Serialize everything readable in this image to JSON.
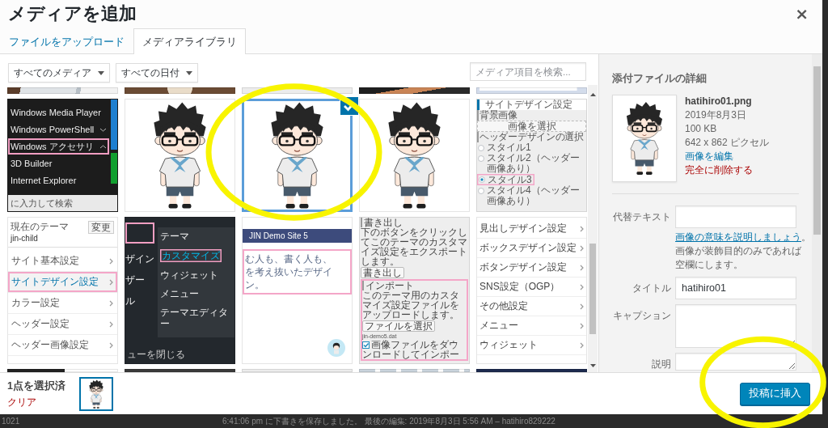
{
  "modal": {
    "title": "メディアを追加",
    "close": "×"
  },
  "tabs": [
    {
      "label": "ファイルをアップロード",
      "selected": false
    },
    {
      "label": "メディアライブラリ",
      "selected": true
    }
  ],
  "filters": [
    {
      "value": "すべてのメディア"
    },
    {
      "value": "すべての日付"
    }
  ],
  "search": {
    "placeholder": "メディア項目を検索..."
  },
  "media_items": [
    {
      "kind": "photo_desk",
      "selected": false,
      "circled": false
    },
    {
      "kind": "photo_coffee",
      "selected": false,
      "circled": false
    },
    {
      "kind": "blank",
      "selected": false,
      "circled": false
    },
    {
      "kind": "photo_hand",
      "selected": false,
      "circled": false
    },
    {
      "kind": "screenshot",
      "selected": false,
      "circled": false
    },
    {
      "kind": "windows_menu",
      "selected": false,
      "circled": false,
      "entries": [
        {
          "kind": "app",
          "label": "Windows Media Player",
          "highlighted": false
        },
        {
          "kind": "folder",
          "label": "Windows PowerShell",
          "highlighted": false,
          "expanded": false
        },
        {
          "kind": "folder",
          "label": "Windows アクセサリ",
          "highlighted": true,
          "expanded": true
        },
        {
          "kind": "app",
          "label": "3D Builder",
          "highlighted": false
        },
        {
          "kind": "app",
          "label": "Internet Explorer",
          "highlighted": false
        }
      ],
      "search_hint": "に入力して検索"
    },
    {
      "kind": "character",
      "selected": false,
      "circled": false
    },
    {
      "kind": "character",
      "selected": true,
      "circled": true
    },
    {
      "kind": "character",
      "selected": false,
      "circled": false
    },
    {
      "kind": "customizer_styles",
      "selected": false,
      "circled": false,
      "panel_title": "サイトデザイン設定",
      "section": "背景画像",
      "button": "画像を選択",
      "heading": "ヘッダーデザインの選択",
      "options": [
        {
          "label": "スタイル1",
          "selected": false,
          "highlighted": false
        },
        {
          "label": "スタイル2（ヘッダー画像あり）",
          "selected": false,
          "highlighted": false
        },
        {
          "label": "スタイル3",
          "selected": true,
          "highlighted": true
        },
        {
          "label": "スタイル4（ヘッダー画像あり）",
          "selected": false,
          "highlighted": false
        }
      ]
    },
    {
      "kind": "theme_panel",
      "selected": false,
      "circled": false,
      "caption": "現在のテーマ",
      "theme": "jin-child",
      "button": "変更",
      "entries": [
        {
          "label": "サイト基本設定",
          "highlighted": false
        },
        {
          "label": "サイトデザイン設定",
          "highlighted": true
        },
        {
          "label": "カラー設定",
          "highlighted": false
        },
        {
          "label": "ヘッダー設定",
          "highlighted": false
        },
        {
          "label": "ヘッダー画像設定",
          "highlighted": false
        }
      ]
    },
    {
      "kind": "admin_menu",
      "selected": false,
      "circled": false,
      "side_frame": true,
      "side_entries": [
        "ザイン",
        "ザー",
        "ル"
      ],
      "footer": "ューを閉じる",
      "entries": [
        {
          "label": "テーマ",
          "highlighted": false
        },
        {
          "label": "カスタマイズ",
          "highlighted": true
        },
        {
          "label": "ウィジェット",
          "highlighted": false
        },
        {
          "label": "メニュー",
          "highlighted": false
        },
        {
          "label": "テーマエディター",
          "highlighted": false
        }
      ]
    },
    {
      "kind": "demo_site",
      "selected": false,
      "circled": false,
      "site_title": "JIN Demo Site 5",
      "highlighted": true,
      "lines": [
        "む人も、書く人も、",
        "を考え抜いたデザイン。"
      ]
    },
    {
      "kind": "export_import",
      "selected": false,
      "circled": false,
      "export_heading": "書き出し",
      "export_text": "下のボタンをクリックしてこのテーマのカスタマイズ設定をエクスポートします。",
      "export_button": "書き出し",
      "highlighted": true,
      "import_heading": "インポート",
      "import_text": "このテーマ用のカスタマイズ設定ファイルをアップロードします。",
      "file_button": "ファイルを選択",
      "file_name": "jin-demo5.dat",
      "checkbox": {
        "label": "画像ファイルをダウンロードしてインポー",
        "checked": true
      }
    },
    {
      "kind": "settings_list",
      "selected": false,
      "circled": false,
      "entries": [
        "見出しデザイン設定",
        "ボックスデザイン設定",
        "ボタンデザイン設定",
        "SNS設定（OGP）",
        "その他設定",
        "メニュー",
        "ウィジェット"
      ]
    },
    {
      "kind": "dark_split",
      "selected": false,
      "circled": false
    },
    {
      "kind": "dark",
      "selected": false,
      "circled": false
    },
    {
      "kind": "blank",
      "selected": false,
      "circled": false
    },
    {
      "kind": "collage",
      "selected": false,
      "circled": false
    },
    {
      "kind": "navy",
      "selected": false,
      "circled": false
    }
  ],
  "attachment_details": {
    "heading": "添付ファイルの詳細",
    "filename": "hatihiro01.png",
    "date": "2019年8月3日",
    "size": "100 KB",
    "dimensions": "642 x 862 ピクセル",
    "edit_link": "画像を編集",
    "delete_link": "完全に削除する",
    "fields": [
      {
        "kind": "input",
        "label": "代替テキスト",
        "help": {
          "link": "画像の意味を説明しましょう",
          "text": "。画像が装飾目的のみであれば空欄にします。"
        }
      },
      {
        "kind": "input",
        "label": "タイトル",
        "value": "hatihiro01"
      },
      {
        "kind": "textarea",
        "label": "キャプション"
      },
      {
        "kind": "textarea",
        "label": "説明"
      }
    ]
  },
  "selection": {
    "count": "1点を選択済",
    "clear": "クリア"
  },
  "insert_button": {
    "label": "投稿に挿入",
    "circled": true
  },
  "background_page": {
    "word_count": "1021",
    "status": "6:41:06 pm に下書きを保存しました。 最後の編集: 2019年8月3日 5:56 AM – hatihiro829222"
  }
}
